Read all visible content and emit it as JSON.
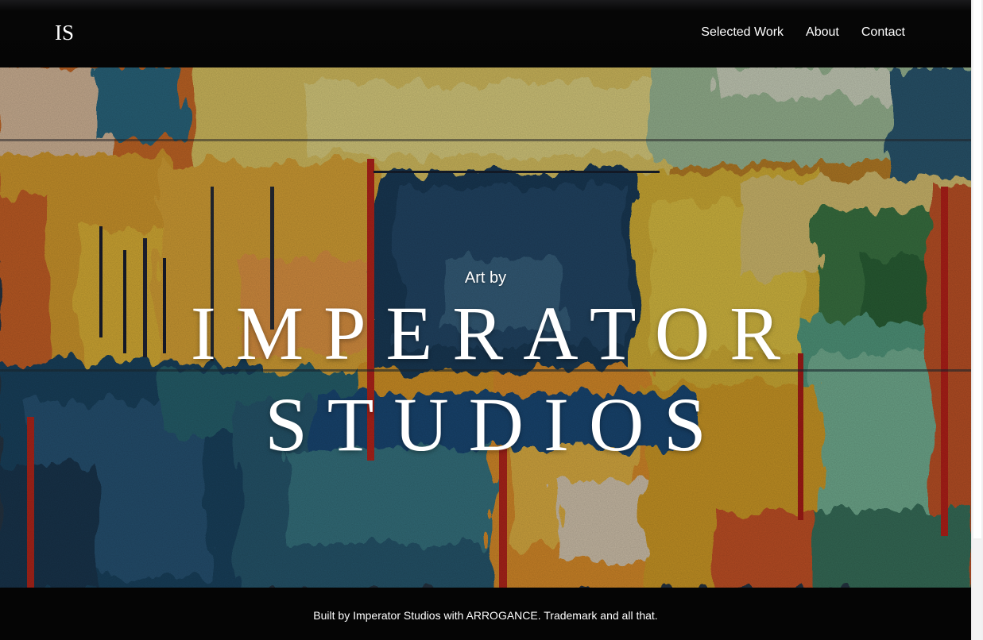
{
  "nav": {
    "logo": "IS",
    "links": [
      {
        "label": "Selected Work"
      },
      {
        "label": "About"
      },
      {
        "label": "Contact"
      }
    ]
  },
  "hero": {
    "subtitle": "Art by",
    "title_line1": "IMPERATOR",
    "title_line2": "STUDIOS",
    "background": "abstract-painting-image"
  },
  "footer": {
    "text": "Built by Imperator Studios with ARROGANCE. Trademark and all that."
  },
  "colors": {
    "nav_background": "#050505",
    "text": "#ffffff",
    "painting_yellow": "#e8b52a",
    "painting_blue": "#1d4a6b",
    "painting_red": "#c8281e",
    "painting_green": "#3d8a64"
  }
}
